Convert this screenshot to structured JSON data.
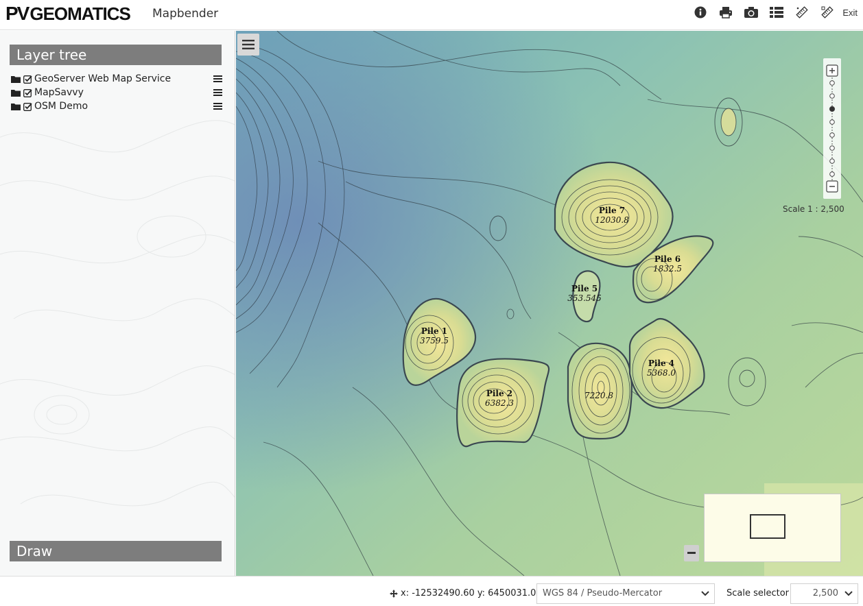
{
  "header": {
    "logo_pv": "PV",
    "logo_text": "GEOMATICS",
    "app_title": "Mapbender",
    "toolbar": [
      {
        "icon": "info-icon"
      },
      {
        "icon": "print-icon"
      },
      {
        "icon": "camera-icon"
      },
      {
        "icon": "legend-icon"
      },
      {
        "icon": "measure-line-icon"
      },
      {
        "icon": "measure-area-icon"
      }
    ],
    "exit_label": "Exit"
  },
  "sidebar": {
    "layer_tree_title": "Layer tree",
    "layers": [
      {
        "label": "GeoServer Web Map Service",
        "checked": true
      },
      {
        "label": "MapSavvy",
        "checked": true
      },
      {
        "label": "OSM Demo",
        "checked": true
      }
    ],
    "draw_title": "Draw"
  },
  "map": {
    "scale_text": "Scale 1 : 2,500",
    "zoom_levels": 9,
    "zoom_active_index": 3,
    "piles": [
      {
        "name": "Pile 7",
        "value": "12030.8"
      },
      {
        "name": "Pile 6",
        "value": "1832.5"
      },
      {
        "name": "Pile 5",
        "value": "353.545"
      },
      {
        "name": "Pile 1",
        "value": "3759.5"
      },
      {
        "name": "Pile 2",
        "value": "6382.3"
      },
      {
        "name": "Pile 4",
        "value": "5368.0"
      },
      {
        "name": "",
        "value": "7220.8"
      }
    ]
  },
  "footer": {
    "coordinates": "x: -12532490.60 y: 6450031.00",
    "srs_value": "WGS 84 / Pseudo-Mercator",
    "scale_selector_label": "Scale selector",
    "scale_value": "2,500"
  }
}
